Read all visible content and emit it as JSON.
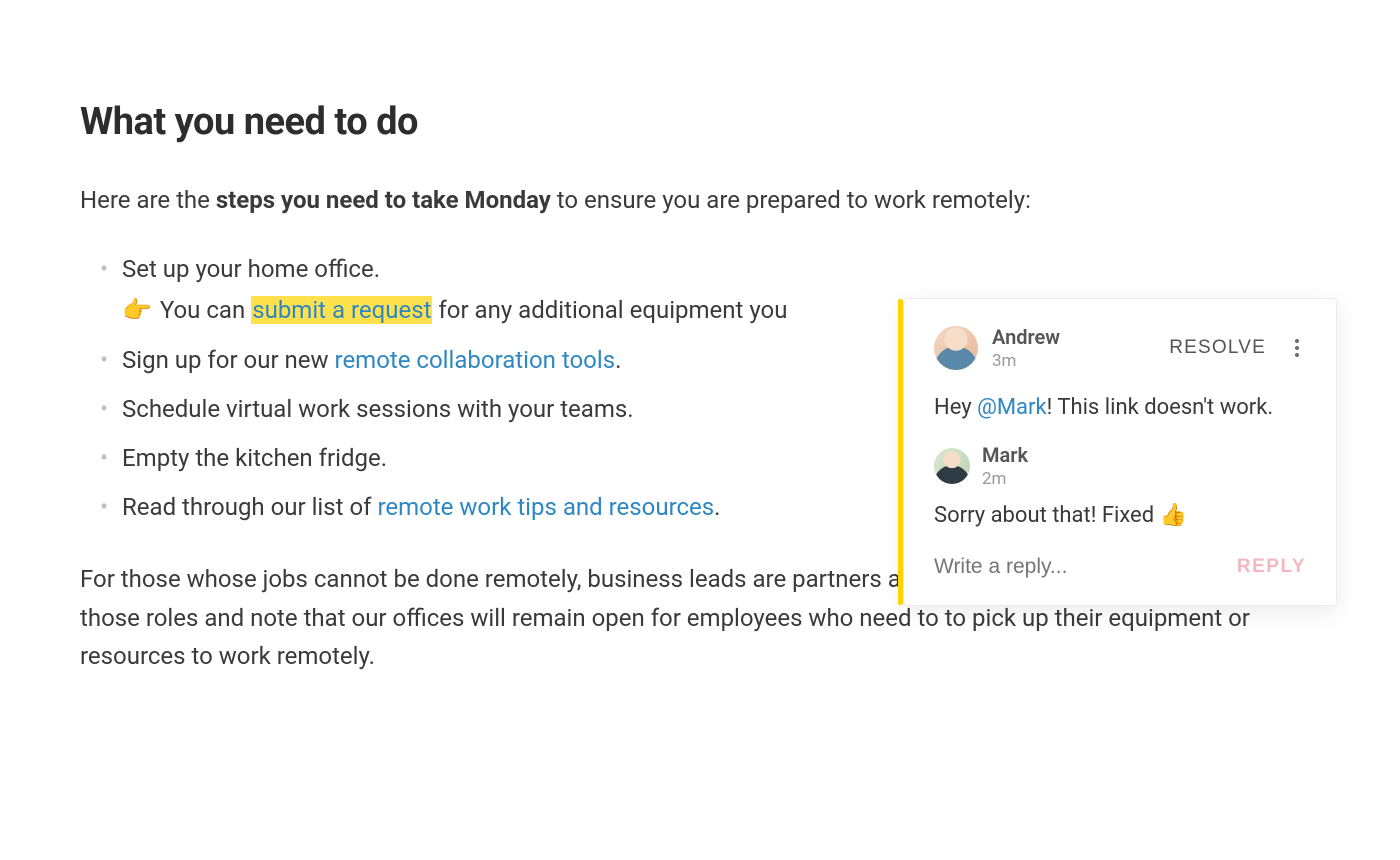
{
  "heading": "What you need to do",
  "intro": {
    "pre": "Here are the ",
    "bold": "steps you need to take Monday",
    "post": " to ensure you are prepared to work remotely:"
  },
  "steps": {
    "item1": {
      "text": "Set up your home office.",
      "sub_emoji": "👉",
      "sub_pre": " You can ",
      "sub_link": "submit a request",
      "sub_post": " for any additional equipment you"
    },
    "item2": {
      "pre": "Sign up for our new ",
      "link": "remote collaboration tools",
      "post": "."
    },
    "item3": {
      "text": "Schedule virtual work sessions with your teams."
    },
    "item4": {
      "text": "Empty the kitchen fridge."
    },
    "item5": {
      "pre": "Read through our list of ",
      "link": "remote work tips and resources",
      "post": "."
    }
  },
  "followup": "For those whose jobs cannot be done remotely, business leads are partners and managers to support employees in those roles and note that our offices will remain open for employees who need to to pick up their equipment or resources to work remotely.",
  "comments": {
    "c1": {
      "author": "Andrew",
      "time": "3m",
      "body_pre": "Hey ",
      "mention": "@Mark",
      "body_post": "! This link doesn't work."
    },
    "c2": {
      "author": "Mark",
      "time": "2m",
      "body": "Sorry about that! Fixed 👍"
    },
    "resolve_label": "RESOLVE",
    "reply_placeholder": "Write a reply...",
    "reply_button": "REPLY"
  }
}
